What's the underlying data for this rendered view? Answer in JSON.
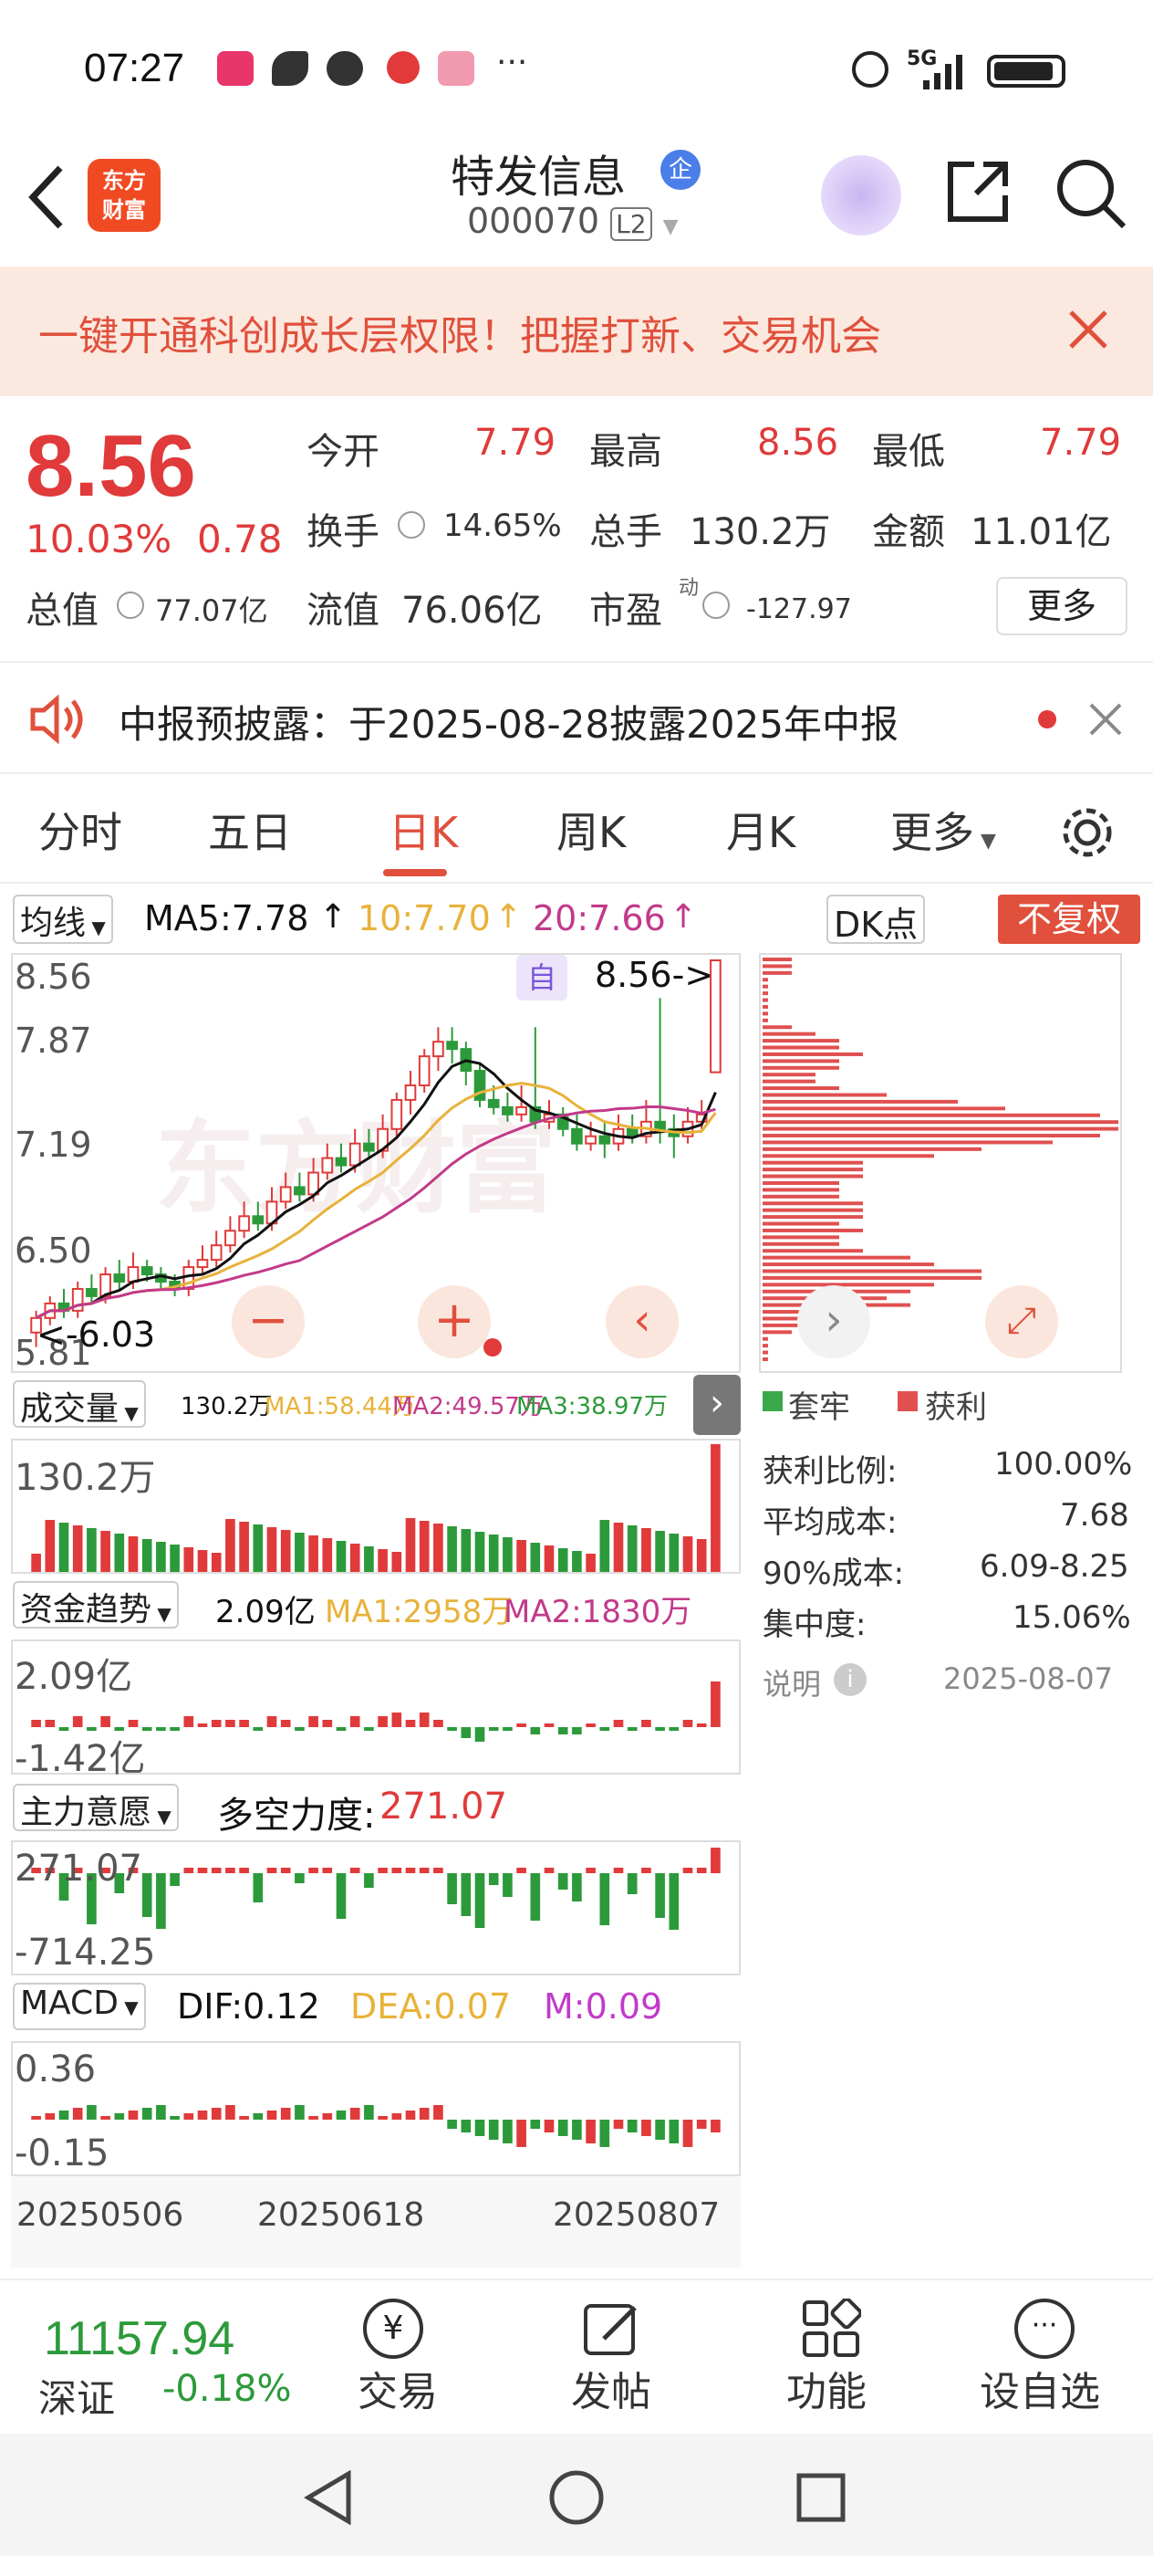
{
  "status": {
    "time": "07:27",
    "network": "5G"
  },
  "header": {
    "logo_line1": "东方",
    "logo_line2": "财富",
    "stock_name": "特发信息",
    "name_badge": "企",
    "stock_code": "000070",
    "level": "L2"
  },
  "banner": {
    "text": "一键开通科创成长层权限！把握打新、交易机会"
  },
  "quote": {
    "price": "8.56",
    "change_pct": "10.03%",
    "change": "0.78",
    "open_label": "今开",
    "open": "7.79",
    "high_label": "最高",
    "high": "8.56",
    "low_label": "最低",
    "low": "7.79",
    "turnover_label": "换手",
    "turnover": "14.65%",
    "volume_label": "总手",
    "volume": "130.2万",
    "amount_label": "金额",
    "amount": "11.01亿",
    "mktcap_label": "总值",
    "mktcap": "77.07亿",
    "float_label": "流值",
    "float": "76.06亿",
    "pe_label": "市盈",
    "pe_sup": "动",
    "pe": "-127.97",
    "more": "更多"
  },
  "notice": {
    "text": "中报预披露：于2025-08-28披露2025年中报"
  },
  "tabs": [
    "分时",
    "五日",
    "日K",
    "周K",
    "月K",
    "更多"
  ],
  "kline": {
    "ma_select": "均线",
    "ma5": "MA5:7.78",
    "ma10": "10:7.70",
    "ma20": "20:7.66",
    "dk": "DK点",
    "fq": "不复权",
    "price_labels": [
      "8.56",
      "7.87",
      "7.19",
      "6.50",
      "5.81"
    ],
    "zi": "自",
    "high_marker": "8.56->",
    "low_marker": "<-6.03",
    "colors": {
      "up": "#e03a3a",
      "down": "#2c9a3a",
      "ma5": "#111111",
      "ma10": "#e8b23a",
      "ma20": "#c23a8a"
    },
    "candles": [
      [
        6.0,
        6.1,
        5.9,
        6.15
      ],
      [
        6.1,
        6.2,
        6.05,
        6.25
      ],
      [
        6.2,
        6.15,
        6.1,
        6.3
      ],
      [
        6.15,
        6.3,
        6.1,
        6.35
      ],
      [
        6.3,
        6.25,
        6.2,
        6.4
      ],
      [
        6.25,
        6.4,
        6.2,
        6.45
      ],
      [
        6.4,
        6.35,
        6.3,
        6.5
      ],
      [
        6.35,
        6.45,
        6.3,
        6.55
      ],
      [
        6.45,
        6.4,
        6.35,
        6.5
      ],
      [
        6.4,
        6.35,
        6.3,
        6.45
      ],
      [
        6.35,
        6.3,
        6.25,
        6.4
      ],
      [
        6.3,
        6.45,
        6.25,
        6.5
      ],
      [
        6.45,
        6.5,
        6.4,
        6.6
      ],
      [
        6.5,
        6.6,
        6.45,
        6.7
      ],
      [
        6.6,
        6.7,
        6.55,
        6.8
      ],
      [
        6.7,
        6.8,
        6.65,
        6.9
      ],
      [
        6.8,
        6.75,
        6.7,
        6.9
      ],
      [
        6.75,
        6.9,
        6.7,
        7.0
      ],
      [
        6.9,
        7.0,
        6.85,
        7.1
      ],
      [
        7.0,
        6.95,
        6.9,
        7.1
      ],
      [
        6.95,
        7.1,
        6.9,
        7.2
      ],
      [
        7.1,
        7.2,
        7.05,
        7.3
      ],
      [
        7.2,
        7.15,
        7.1,
        7.3
      ],
      [
        7.15,
        7.3,
        7.1,
        7.4
      ],
      [
        7.3,
        7.25,
        7.2,
        7.4
      ],
      [
        7.25,
        7.4,
        7.2,
        7.5
      ],
      [
        7.4,
        7.6,
        7.35,
        7.65
      ],
      [
        7.6,
        7.7,
        7.5,
        7.8
      ],
      [
        7.7,
        7.9,
        7.65,
        7.95
      ],
      [
        7.9,
        8.0,
        7.8,
        8.1
      ],
      [
        8.0,
        7.95,
        7.85,
        8.1
      ],
      [
        7.95,
        7.8,
        7.7,
        8.0
      ],
      [
        7.8,
        7.6,
        7.55,
        7.85
      ],
      [
        7.6,
        7.55,
        7.5,
        7.7
      ],
      [
        7.55,
        7.5,
        7.45,
        7.65
      ],
      [
        7.5,
        7.55,
        7.45,
        7.7
      ],
      [
        7.55,
        7.45,
        7.4,
        8.1
      ],
      [
        7.45,
        7.5,
        7.4,
        7.6
      ],
      [
        7.5,
        7.4,
        7.35,
        7.55
      ],
      [
        7.4,
        7.3,
        7.25,
        7.5
      ],
      [
        7.3,
        7.35,
        7.25,
        7.45
      ],
      [
        7.35,
        7.3,
        7.2,
        7.45
      ],
      [
        7.3,
        7.4,
        7.25,
        7.5
      ],
      [
        7.4,
        7.35,
        7.3,
        7.5
      ],
      [
        7.35,
        7.45,
        7.3,
        7.6
      ],
      [
        7.45,
        7.4,
        7.3,
        8.3
      ],
      [
        7.4,
        7.35,
        7.2,
        7.5
      ],
      [
        7.35,
        7.45,
        7.3,
        7.55
      ],
      [
        7.45,
        7.5,
        7.4,
        7.6
      ],
      [
        7.79,
        8.56,
        7.79,
        8.56
      ]
    ],
    "vol_label": "成交量",
    "vol_values": "130.2万",
    "vol_ma1": "MA1:58.44万",
    "vol_ma2": "MA2:49.57万",
    "vol_ma3": "MA3:38.97万",
    "vol_axis": "130.2万",
    "fund_label": "资金趋势",
    "fund_value": "2.09亿",
    "fund_ma1": "MA1:2958万",
    "fund_ma2": "MA2:1830万",
    "fund_top": "2.09亿",
    "fund_bottom": "-1.42亿",
    "power_label": "主力意愿",
    "power_text": "多空力度:",
    "power_value": "271.07",
    "power_top": "271.07",
    "power_bottom": "-714.25",
    "macd_label": "MACD",
    "dif": "DIF:0.12",
    "dea": "DEA:0.07",
    "m": "M:0.09",
    "macd_top": "0.36",
    "macd_bottom": "-0.15",
    "dates": [
      "20250506",
      "20250618",
      "20250807"
    ]
  },
  "chips": {
    "win_label": "套牢",
    "lose_label": "获利",
    "rows": [
      {
        "k": "获利比例:",
        "v": "100.00%"
      },
      {
        "k": "平均成本:",
        "v": "7.68"
      },
      {
        "k": "90%成本:",
        "v": "6.09-8.25"
      },
      {
        "k": "集中度:",
        "v": "15.06%"
      }
    ],
    "note": "说明",
    "date": "2025-08-07"
  },
  "bottom": {
    "index_value": "11157.94",
    "index_name": "深证",
    "index_change": "-0.18%",
    "trade": "交易",
    "post": "发帖",
    "func": "功能",
    "watch": "设自选"
  }
}
